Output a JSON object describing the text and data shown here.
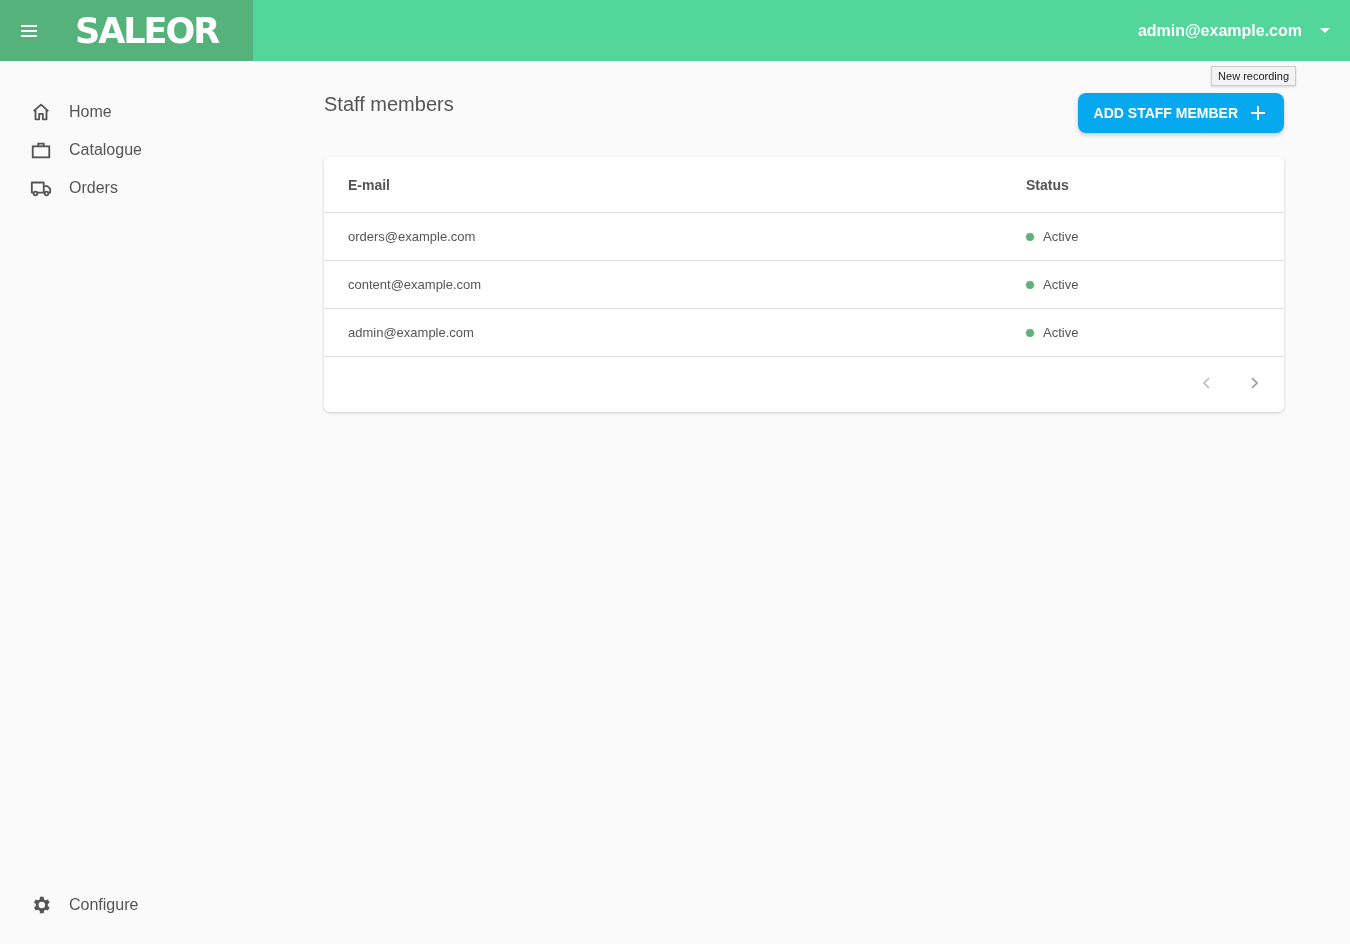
{
  "header": {
    "logo": "SALEOR",
    "user_email": "admin@example.com"
  },
  "tooltip": "New recording",
  "sidebar": {
    "items": [
      {
        "label": "Home",
        "kind": "home"
      },
      {
        "label": "Catalogue",
        "kind": "catalogue"
      },
      {
        "label": "Orders",
        "kind": "orders"
      }
    ],
    "footer_item": {
      "label": "Configure",
      "kind": "configure"
    }
  },
  "page": {
    "title": "Staff members",
    "add_button": "ADD STAFF MEMBER"
  },
  "table": {
    "columns": [
      "E-mail",
      "Status"
    ],
    "rows": [
      {
        "email": "orders@example.com",
        "status": "Active",
        "color": "#5ab378"
      },
      {
        "email": "content@example.com",
        "status": "Active",
        "color": "#5ab378"
      },
      {
        "email": "admin@example.com",
        "status": "Active",
        "color": "#5ab378"
      }
    ]
  }
}
